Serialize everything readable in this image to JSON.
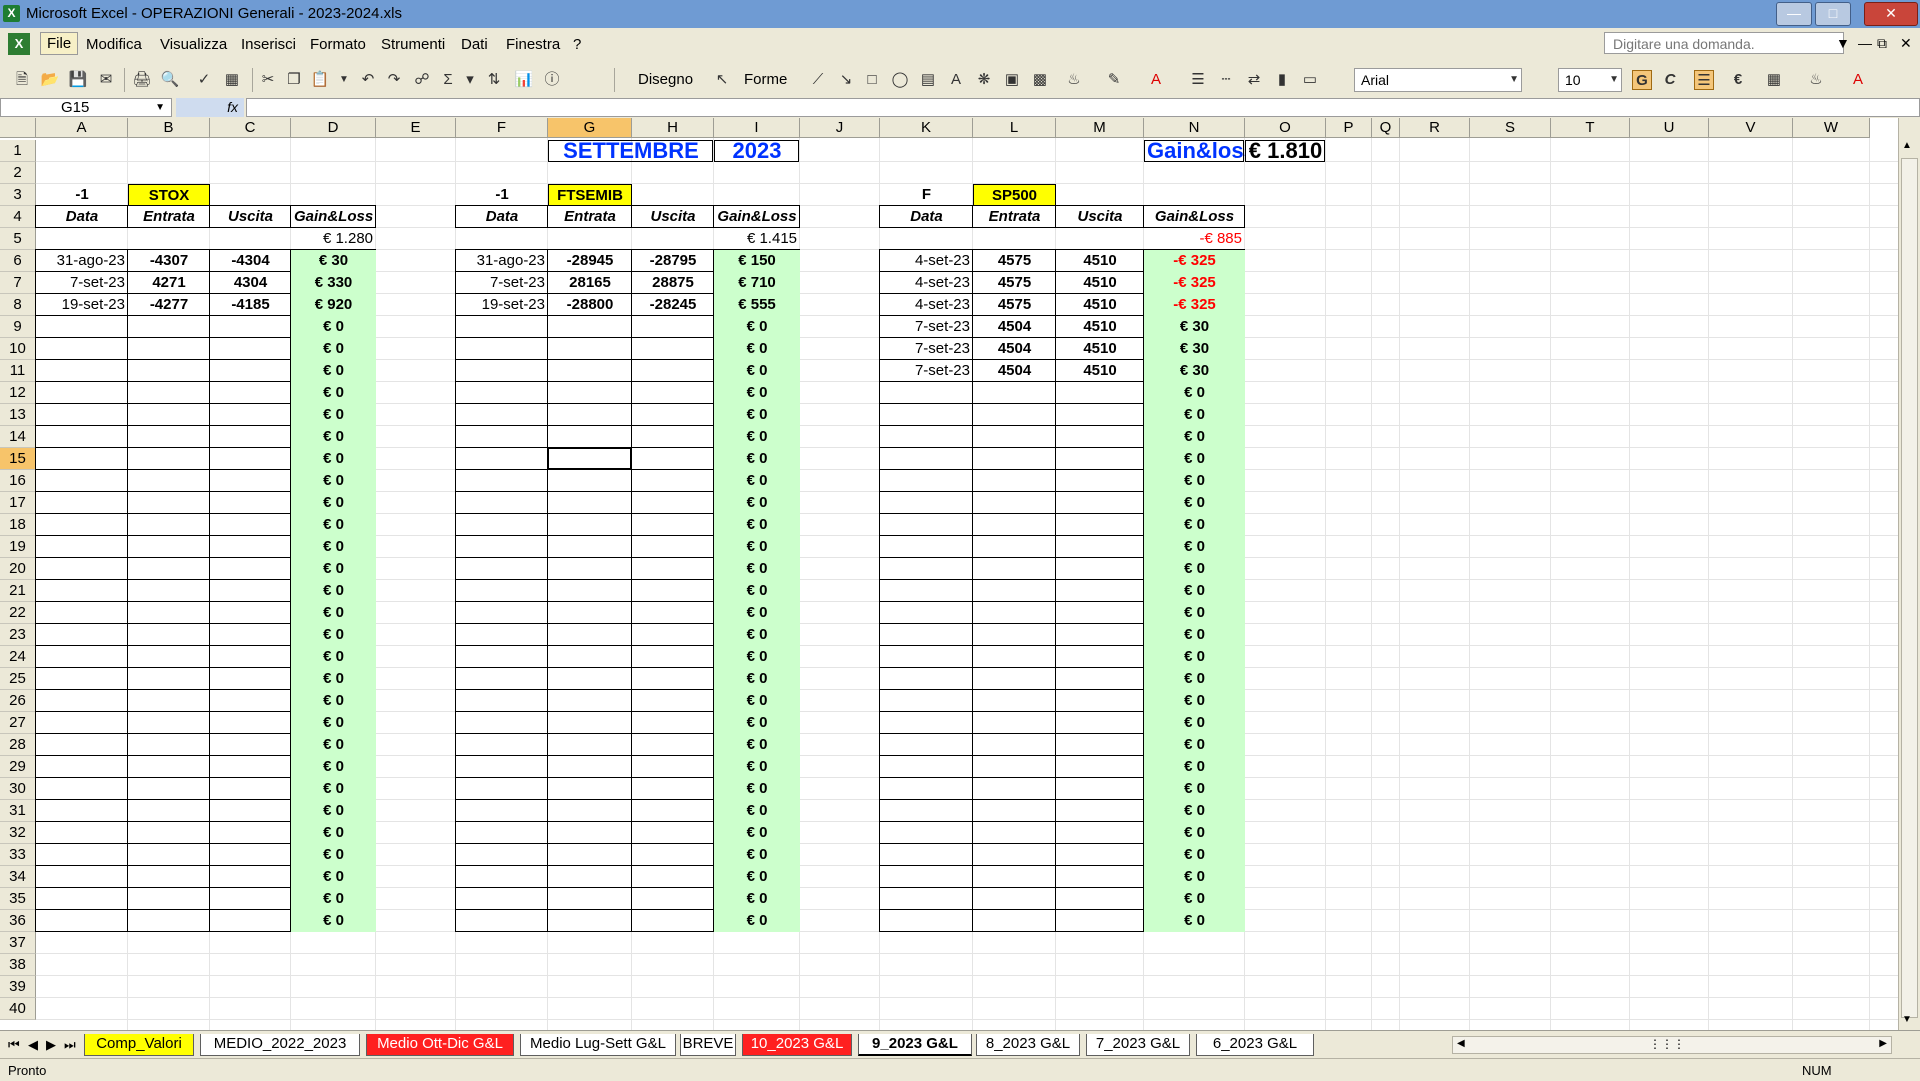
{
  "window": {
    "title": "Microsoft Excel - OPERAZIONI Generali - 2023-2024.xls"
  },
  "menu": [
    "File",
    "Modifica",
    "Visualizza",
    "Inserisci",
    "Formato",
    "Strumenti",
    "Dati",
    "Finestra",
    "?"
  ],
  "help_placeholder": "Digitare una domanda.",
  "toolbar": {
    "draw_label": "Disegno",
    "shapes_label": "Forme",
    "font": "Arial",
    "font_size": "10",
    "bold": "G",
    "italic": "C"
  },
  "formula_bar": {
    "name_box": "G15",
    "fx": "fx"
  },
  "columns": [
    "A",
    "B",
    "C",
    "D",
    "E",
    "F",
    "G",
    "H",
    "I",
    "J",
    "K",
    "L",
    "M",
    "N",
    "O",
    "P",
    "Q",
    "R",
    "S",
    "T",
    "U",
    "V",
    "W"
  ],
  "rows": [
    "1",
    "2",
    "3",
    "4",
    "5",
    "6",
    "7",
    "8",
    "9",
    "10",
    "11",
    "12",
    "13",
    "14",
    "15",
    "16",
    "17",
    "18",
    "19",
    "20",
    "21",
    "22",
    "23",
    "24",
    "25",
    "26",
    "27",
    "28",
    "29",
    "30",
    "31",
    "32",
    "33",
    "34",
    "35",
    "36",
    "37",
    "38",
    "39",
    "40"
  ],
  "header": {
    "month": "SETTEMBRE",
    "year": "2023",
    "gl_label": "Gain&loss",
    "gl_total": "€ 1.810"
  },
  "blocks": [
    {
      "sign": "-1",
      "name": "STOX",
      "total": "€ 1.280",
      "headers": [
        "Data",
        "Entrata",
        "Uscita",
        "Gain&Loss"
      ],
      "rows": [
        [
          "31-ago-23",
          "-4307",
          "-4304",
          "€ 30"
        ],
        [
          "7-set-23",
          "4271",
          "4304",
          "€ 330"
        ],
        [
          "19-set-23",
          "-4277",
          "-4185",
          "€ 920"
        ]
      ]
    },
    {
      "sign": "-1",
      "name": "FTSEMIB",
      "total": "€ 1.415",
      "headers": [
        "Data",
        "Entrata",
        "Uscita",
        "Gain&Loss"
      ],
      "rows": [
        [
          "31-ago-23",
          "-28945",
          "-28795",
          "€ 150"
        ],
        [
          "7-set-23",
          "28165",
          "28875",
          "€ 710"
        ],
        [
          "19-set-23",
          "-28800",
          "-28245",
          "€ 555"
        ]
      ]
    },
    {
      "sign": "F",
      "name": "SP500",
      "total": "-€ 885",
      "headers": [
        "Data",
        "Entrata",
        "Uscita",
        "Gain&Loss"
      ],
      "rows": [
        [
          "4-set-23",
          "4575",
          "4510",
          "-€ 325"
        ],
        [
          "4-set-23",
          "4575",
          "4510",
          "-€ 325"
        ],
        [
          "4-set-23",
          "4575",
          "4510",
          "-€ 325"
        ],
        [
          "7-set-23",
          "4504",
          "4510",
          "€ 30"
        ],
        [
          "7-set-23",
          "4504",
          "4510",
          "€ 30"
        ],
        [
          "7-set-23",
          "4504",
          "4510",
          "€ 30"
        ]
      ]
    }
  ],
  "empty_gl": "€ 0",
  "sheet_tabs": [
    "Comp_Valori",
    "MEDIO_2022_2023",
    "Medio Ott-Dic G&L",
    "Medio Lug-Sett G&L",
    "BREVE",
    "10_2023 G&L",
    "9_2023 G&L",
    "8_2023 G&L",
    "7_2023 G&L",
    "6_2023 G&L"
  ],
  "status": {
    "left": "Pronto",
    "right": "NUM"
  }
}
